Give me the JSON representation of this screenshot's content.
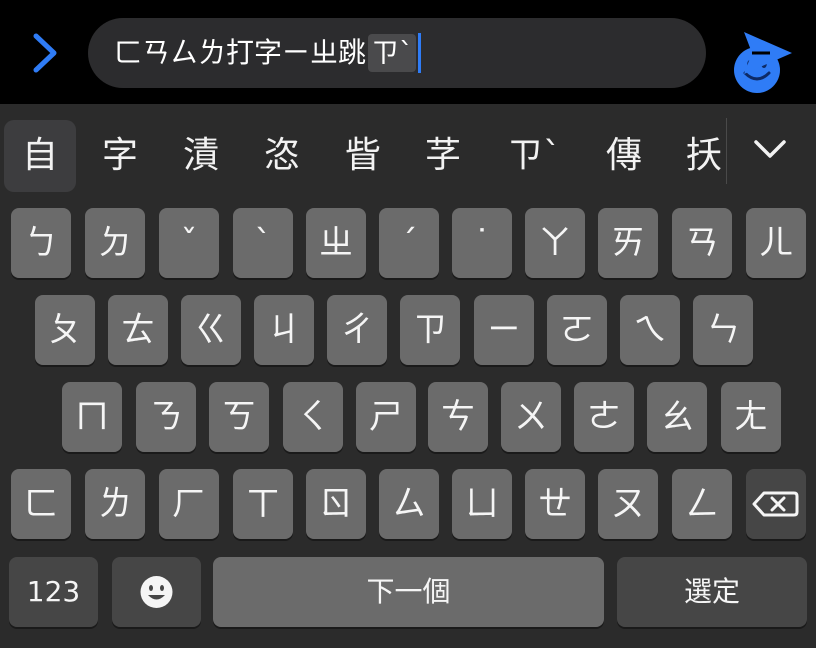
{
  "input": {
    "typed_text": "ㄈㄢㄙㄌ打字ㄧㄓ跳",
    "composing_text": "ㄗˋ",
    "emoji_icon": "smiley-face-icon",
    "expand_icon": "chevron-right-icon",
    "send_icon": "send-arrow-icon",
    "accent_color": "#2f7cf6"
  },
  "candidates": {
    "items": [
      "自",
      "字",
      "漬",
      "恣",
      "眥",
      "芓",
      "ㄗˋ",
      "傳",
      "扷"
    ],
    "selected_index": 0,
    "more_icon": "chevron-down-icon"
  },
  "keyboard": {
    "row1": [
      "ㄅ",
      "ㄉ",
      "ˇ",
      "ˋ",
      "ㄓ",
      "ˊ",
      "˙",
      "ㄚ",
      "ㄞ",
      "ㄢ",
      "ㄦ"
    ],
    "row2": [
      "ㄆ",
      "ㄊ",
      "ㄍ",
      "ㄐ",
      "ㄔ",
      "ㄗ",
      "ㄧ",
      "ㄛ",
      "ㄟ",
      "ㄣ"
    ],
    "row3": [
      "ㄇ",
      "ㄋ",
      "ㄎ",
      "ㄑ",
      "ㄕ",
      "ㄘ",
      "ㄨ",
      "ㄜ",
      "ㄠ",
      "ㄤ"
    ],
    "row4": [
      "ㄈ",
      "ㄌ",
      "ㄏ",
      "ㄒ",
      "ㄖ",
      "ㄙ",
      "ㄩ",
      "ㄝ",
      "ㄡ",
      "ㄥ"
    ],
    "delete_icon": "backspace-icon",
    "numbers_label": "123",
    "emoji_key_icon": "emoji-icon",
    "space_label": "下一個",
    "confirm_label": "選定"
  }
}
